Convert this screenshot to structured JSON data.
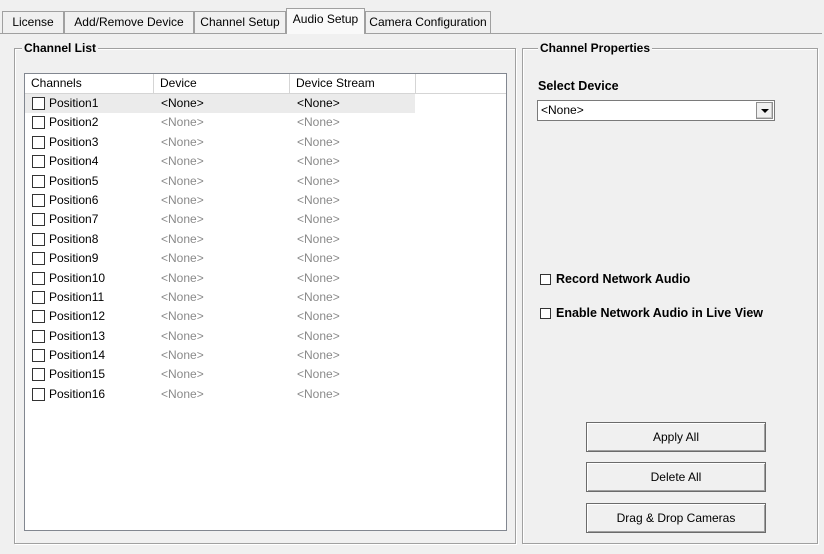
{
  "tabs": [
    {
      "label": "License"
    },
    {
      "label": "Add/Remove Device"
    },
    {
      "label": "Channel Setup"
    },
    {
      "label": "Audio Setup",
      "active": true
    },
    {
      "label": "Camera Configuration"
    }
  ],
  "channel_list": {
    "title": "Channel List",
    "columns": [
      "Channels",
      "Device",
      "Device Stream"
    ],
    "rows": [
      {
        "channel": "Position1",
        "device": "<None>",
        "stream": "<None>",
        "checked": false,
        "selected": true
      },
      {
        "channel": "Position2",
        "device": "<None>",
        "stream": "<None>",
        "checked": false
      },
      {
        "channel": "Position3",
        "device": "<None>",
        "stream": "<None>",
        "checked": false
      },
      {
        "channel": "Position4",
        "device": "<None>",
        "stream": "<None>",
        "checked": false
      },
      {
        "channel": "Position5",
        "device": "<None>",
        "stream": "<None>",
        "checked": false
      },
      {
        "channel": "Position6",
        "device": "<None>",
        "stream": "<None>",
        "checked": false
      },
      {
        "channel": "Position7",
        "device": "<None>",
        "stream": "<None>",
        "checked": false
      },
      {
        "channel": "Position8",
        "device": "<None>",
        "stream": "<None>",
        "checked": false
      },
      {
        "channel": "Position9",
        "device": "<None>",
        "stream": "<None>",
        "checked": false
      },
      {
        "channel": "Position10",
        "device": "<None>",
        "stream": "<None>",
        "checked": false
      },
      {
        "channel": "Position11",
        "device": "<None>",
        "stream": "<None>",
        "checked": false
      },
      {
        "channel": "Position12",
        "device": "<None>",
        "stream": "<None>",
        "checked": false
      },
      {
        "channel": "Position13",
        "device": "<None>",
        "stream": "<None>",
        "checked": false
      },
      {
        "channel": "Position14",
        "device": "<None>",
        "stream": "<None>",
        "checked": false
      },
      {
        "channel": "Position15",
        "device": "<None>",
        "stream": "<None>",
        "checked": false
      },
      {
        "channel": "Position16",
        "device": "<None>",
        "stream": "<None>",
        "checked": false
      }
    ]
  },
  "properties": {
    "title": "Channel Properties",
    "select_device_label": "Select Device",
    "device_value": "<None>",
    "record_audio_label": "Record Network Audio",
    "record_audio_checked": false,
    "live_audio_label": "Enable Network Audio in Live View",
    "live_audio_checked": false,
    "apply_all_label": "Apply All",
    "delete_all_label": "Delete All",
    "drag_drop_label": "Drag & Drop Cameras"
  }
}
